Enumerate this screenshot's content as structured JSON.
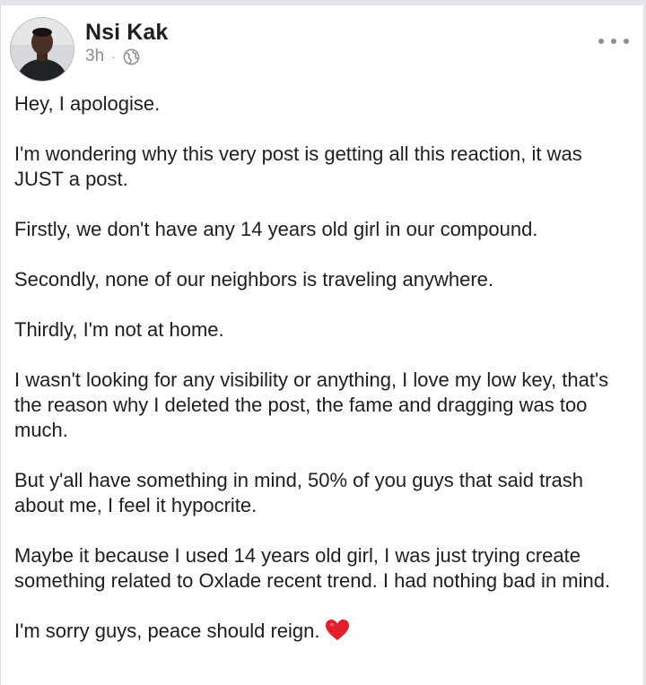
{
  "post": {
    "author": "Nsi Kak",
    "time": "3h",
    "separator": "·",
    "privacy_icon": "globe-icon",
    "more_icon": "more-horizontal-icon",
    "paragraphs": [
      "Hey, I apologise.",
      "I'm wondering why this very post is getting all this reaction, it was JUST a post.",
      "Firstly, we don't have any 14 years old girl in our compound.",
      "Secondly, none of our neighbors is traveling anywhere.",
      "Thirdly, I'm not at home.",
      "I wasn't looking for any visibility or anything, I love my low key, that's the reason why I deleted the post, the fame and dragging was too much.",
      "But y'all have something in mind, 50% of you guys that said trash about me, I feel it hypocrite.",
      "Maybe it because I used 14 years old girl, I was just trying create something related to Oxlade recent trend. I had nothing bad in mind."
    ],
    "closing": "I'm sorry guys, peace should reign.",
    "closing_emoji": "red-heart-icon"
  },
  "colors": {
    "text": "#1c1e21",
    "meta": "#8a8d91",
    "heart": "#e0202b"
  }
}
